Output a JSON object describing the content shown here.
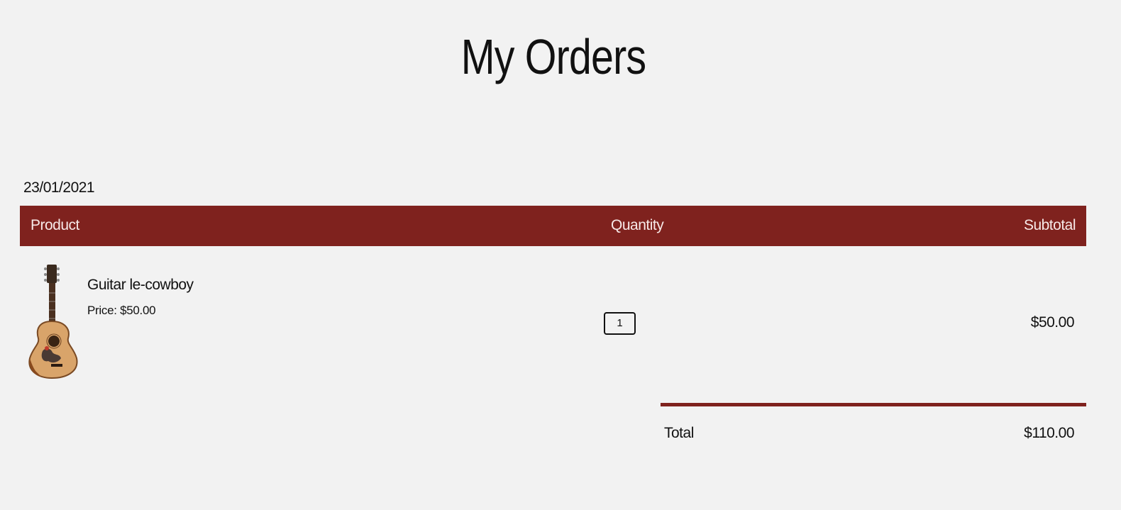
{
  "page": {
    "title": "My Orders"
  },
  "order": {
    "date": "23/01/2021",
    "columns": {
      "product": "Product",
      "quantity": "Quantity",
      "subtotal": "Subtotal"
    },
    "items": [
      {
        "name": "Guitar le-cowboy",
        "price_label": "Price: $50.00",
        "quantity": "1",
        "subtotal": "$50.00",
        "image_icon": "acoustic-guitar-image"
      }
    ],
    "total_label": "Total",
    "total_value": "$110.00"
  },
  "colors": {
    "accent": "#7f221e",
    "background": "#f2f2f2",
    "header_text": "#f7e9e8"
  }
}
